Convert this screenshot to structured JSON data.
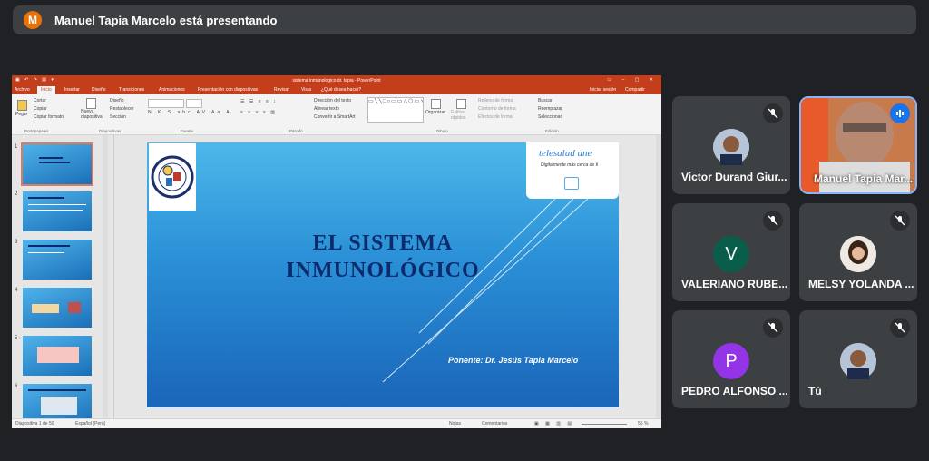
{
  "top_bar": {
    "presenter_initial": "M",
    "presenter_text": "Manuel Tapia Marcelo está presentando",
    "initial_color": "#e8710a"
  },
  "powerpoint": {
    "window_title": "sistema inmunologico dr. tapia - PowerPoint",
    "menu": [
      "Archivo",
      "Inicio",
      "Insertar",
      "Diseño",
      "Transiciones",
      "Animaciones",
      "Presentación con diapositivas",
      "Revisar",
      "Vista",
      "¿Qué desea hacer?"
    ],
    "active_menu": "Inicio",
    "sign_in": "Iniciar sesión",
    "share": "Compartir",
    "ribbon": {
      "paste": "Pegar",
      "cut": "Cortar",
      "copy": "Copiar",
      "format_painter": "Copiar formato",
      "new_slide": "Nueva diapositiva",
      "layout": "Diseño",
      "reset": "Restablecer",
      "section": "Sección",
      "text_direction": "Dirección del texto",
      "align_text": "Alinear texto",
      "smartart": "Convertir a SmartArt",
      "arrange": "Organizar",
      "quick_styles": "Estilos rápidos",
      "shape_fill": "Relleno de forma",
      "shape_outline": "Contorno de forma",
      "shape_effects": "Efectos de forma",
      "find": "Buscar",
      "replace": "Reemplazar",
      "select": "Seleccionar",
      "groups": [
        "Portapapeles",
        "Diapositivas",
        "Fuente",
        "Párrafo",
        "Dibujo",
        "Edición"
      ]
    },
    "slide_numbers": [
      "1",
      "2",
      "3",
      "4",
      "5",
      "6"
    ],
    "slide": {
      "title_line1": "EL SISTEMA",
      "title_line2": "INMUNOLÓGICO",
      "brand": "telesalud une",
      "brand_tagline": "Digitalmente más cerca de ti",
      "speaker": "Ponente: Dr. Jesús Tapia Marcelo"
    },
    "status": {
      "slide_count": "Diapositiva 1 de 50",
      "language": "Español (Perú)",
      "notes": "Notas",
      "comments": "Comentarios",
      "zoom": "55 %"
    }
  },
  "participants": [
    {
      "name": "Victor Durand Giur...",
      "type": "photo",
      "muted": true
    },
    {
      "name": "Manuel Tapia Mar...",
      "type": "video",
      "speaking": true
    },
    {
      "name": "VALERIANO RUBE...",
      "type": "initial",
      "initial": "V",
      "color": "#0b5d4b",
      "muted": true
    },
    {
      "name": "MELSY YOLANDA ...",
      "type": "photo",
      "muted": true
    },
    {
      "name": "PEDRO ALFONSO ...",
      "type": "initial",
      "initial": "P",
      "color": "#9334e6",
      "muted": true
    },
    {
      "name": "Tú",
      "type": "photo",
      "muted": true
    }
  ]
}
